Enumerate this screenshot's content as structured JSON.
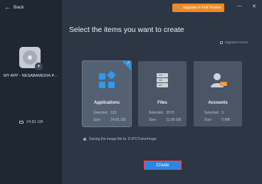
{
  "nav": {
    "back_label": "Back"
  },
  "titlebar": {
    "upgrade_label": "Upgrade to Full Version",
    "minimize_glyph": "—",
    "close_glyph": "✕"
  },
  "sidebar": {
    "app_name": "MY APP - NESABAMEDIA.P...",
    "disk_size": "24.81 GB",
    "icon": "disk-add-icon"
  },
  "main": {
    "heading": "Select the items you want to create",
    "migration_notes": "Migration Notes",
    "cards": [
      {
        "title": "Applications",
        "selected_label": "Selected:",
        "selected_value": "110",
        "size_label": "Size:",
        "size_value": "24.81 GB",
        "icon": "apps-grid-icon",
        "checked": true
      },
      {
        "title": "Files",
        "selected_label": "Selected:",
        "selected_value": "2579",
        "size_label": "Size:",
        "size_value": "11.85 GB",
        "icon": "files-icon",
        "checked": false
      },
      {
        "title": "Accounts",
        "selected_label": "Selected:",
        "selected_value": "0",
        "size_label": "Size:",
        "size_value": "0 MB",
        "icon": "accounts-icon",
        "checked": false
      }
    ],
    "save_path_text": "Saving the image file to: D:\\PCTransImage",
    "create_label": "Create"
  },
  "colors": {
    "accent": "#2f86e0",
    "upgrade": "#f08a24",
    "background": "#2c3645",
    "sidebar": "#1f2733",
    "card": "#4a5666"
  }
}
